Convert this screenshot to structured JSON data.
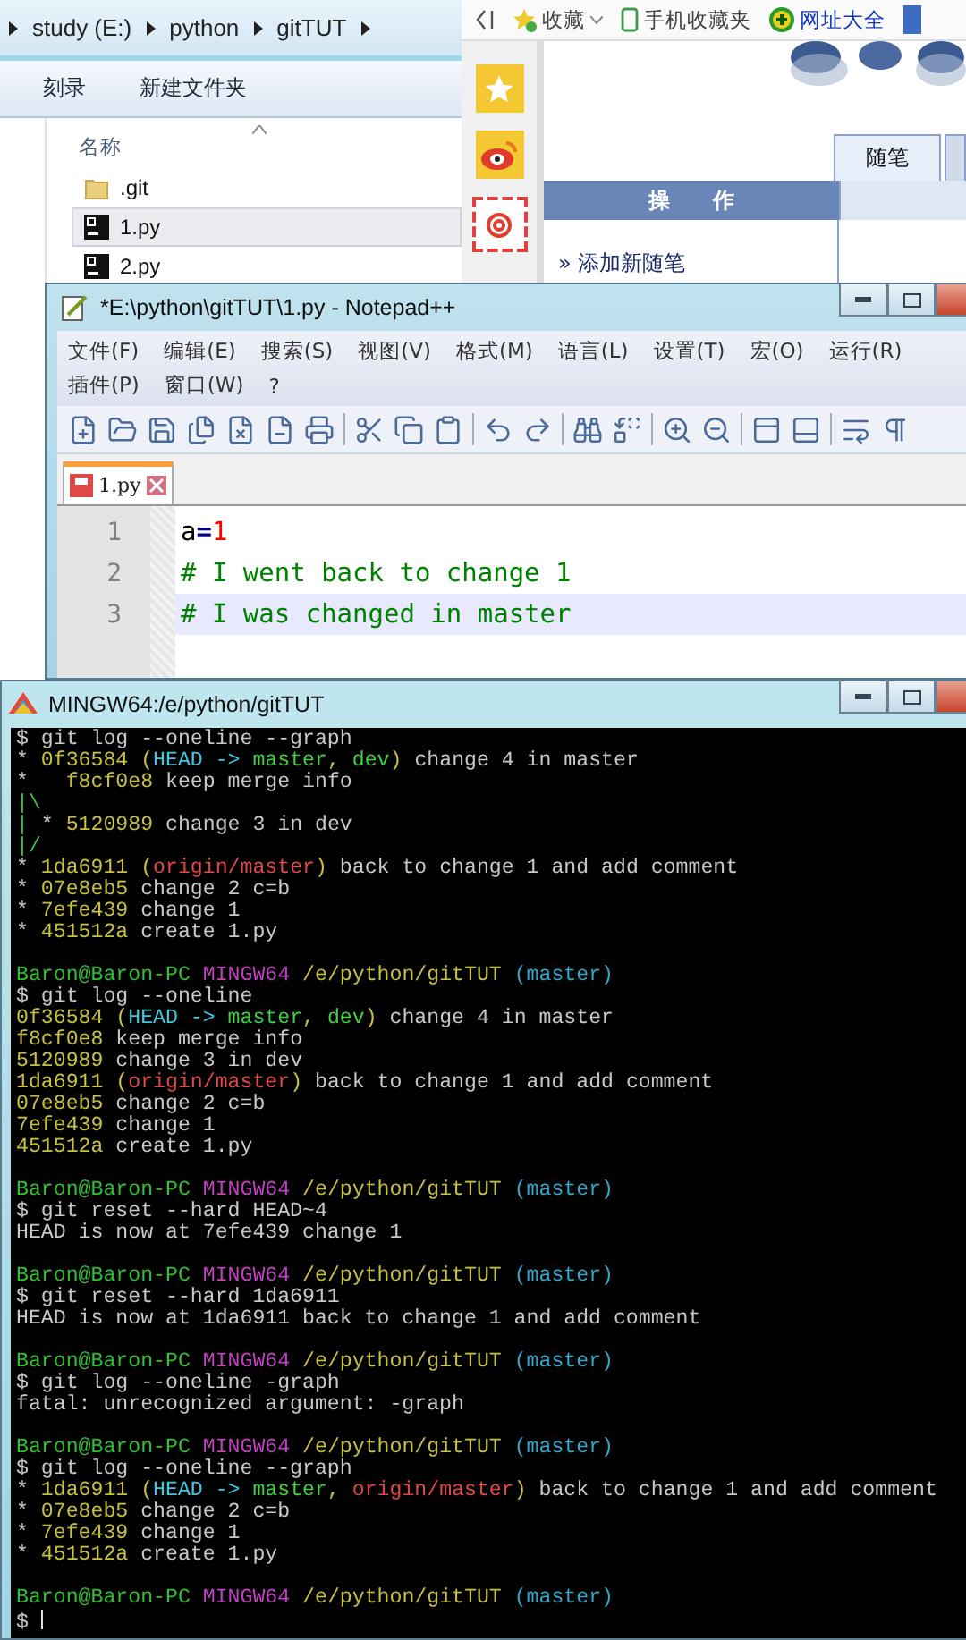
{
  "explorer": {
    "breadcrumb": [
      "study (E:)",
      "python",
      "gitTUT"
    ],
    "toolbar": [
      "刻录",
      "新建文件夹"
    ],
    "column": "名称",
    "files": [
      {
        "name": ".git",
        "kind": "folder",
        "selected": false
      },
      {
        "name": "1.py",
        "kind": "python",
        "selected": true
      },
      {
        "name": "2.py",
        "kind": "python",
        "selected": false
      }
    ]
  },
  "browser": {
    "bookmarks": [
      {
        "label": "收藏",
        "kind": "favorites"
      },
      {
        "label": "手机收藏夹",
        "kind": "phone"
      },
      {
        "label": "网址大全",
        "kind": "nav"
      }
    ],
    "tabs": [
      {
        "label": "随笔",
        "selected": true
      },
      {
        "selected": false
      }
    ],
    "panel_header": "操　　作",
    "link": "» 添加新随笔"
  },
  "notepad": {
    "title": "*E:\\python\\gitTUT\\1.py - Notepad++",
    "menu_rows": [
      [
        "文件(F)",
        "编辑(E)",
        "搜索(S)",
        "视图(V)",
        "格式(M)",
        "语言(L)",
        "设置(T)",
        "宏(O)",
        "运行(R)"
      ],
      [
        "插件(P)",
        "窗口(W)",
        "?"
      ]
    ],
    "tabs": [
      {
        "label": "1.py",
        "selected": true,
        "modified": true
      }
    ],
    "lines": [
      {
        "number": "1",
        "current": false,
        "tokens": [
          {
            "kind": "identifier",
            "text": "a"
          },
          {
            "kind": "operator",
            "text": "="
          },
          {
            "kind": "number",
            "text": "1"
          }
        ]
      },
      {
        "number": "2",
        "current": false,
        "tokens": [
          {
            "kind": "comment",
            "text": "# I went back to change 1"
          }
        ]
      },
      {
        "number": "3",
        "current": true,
        "tokens": [
          {
            "kind": "comment",
            "text": "# I was changed in master"
          }
        ]
      }
    ]
  },
  "terminal": {
    "title": "MINGW64:/e/python/gitTUT",
    "lines": [
      {
        "kind": "output",
        "segments": [
          {
            "kind": "text",
            "text": "$ git log --oneline --graph"
          }
        ]
      },
      {
        "kind": "output",
        "segments": [
          {
            "kind": "text",
            "text": "* "
          },
          {
            "kind": "hash",
            "text": "0f36584"
          },
          {
            "kind": "paren",
            "text": " ("
          },
          {
            "kind": "head",
            "text": "HEAD -> "
          },
          {
            "kind": "branch",
            "text": "master"
          },
          {
            "kind": "paren",
            "text": ", "
          },
          {
            "kind": "branch",
            "text": "dev"
          },
          {
            "kind": "paren",
            "text": ")"
          },
          {
            "kind": "text",
            "text": " change 4 in master"
          }
        ]
      },
      {
        "kind": "output",
        "segments": [
          {
            "kind": "text",
            "text": "*   "
          },
          {
            "kind": "hash",
            "text": "f8cf0e8"
          },
          {
            "kind": "text",
            "text": " keep merge info"
          }
        ]
      },
      {
        "kind": "output",
        "segments": [
          {
            "kind": "graph",
            "text": "|\\"
          }
        ]
      },
      {
        "kind": "output",
        "segments": [
          {
            "kind": "graph",
            "text": "|"
          },
          {
            "kind": "text",
            "text": " * "
          },
          {
            "kind": "hash",
            "text": "5120989"
          },
          {
            "kind": "text",
            "text": " change 3 in dev"
          }
        ]
      },
      {
        "kind": "output",
        "segments": [
          {
            "kind": "graph",
            "text": "|/"
          }
        ]
      },
      {
        "kind": "output",
        "segments": [
          {
            "kind": "text",
            "text": "* "
          },
          {
            "kind": "hash",
            "text": "1da6911"
          },
          {
            "kind": "paren",
            "text": " ("
          },
          {
            "kind": "remote",
            "text": "origin/master"
          },
          {
            "kind": "paren",
            "text": ")"
          },
          {
            "kind": "text",
            "text": " back to change 1 and add comment"
          }
        ]
      },
      {
        "kind": "output",
        "segments": [
          {
            "kind": "text",
            "text": "* "
          },
          {
            "kind": "hash",
            "text": "07e8eb5"
          },
          {
            "kind": "text",
            "text": " change 2 c=b"
          }
        ]
      },
      {
        "kind": "output",
        "segments": [
          {
            "kind": "text",
            "text": "* "
          },
          {
            "kind": "hash",
            "text": "7efe439"
          },
          {
            "kind": "text",
            "text": " change 1"
          }
        ]
      },
      {
        "kind": "output",
        "segments": [
          {
            "kind": "text",
            "text": "* "
          },
          {
            "kind": "hash",
            "text": "451512a"
          },
          {
            "kind": "text",
            "text": " create 1.py"
          }
        ]
      },
      {
        "kind": "blank"
      },
      {
        "kind": "prompt",
        "user": "Baron@Baron-PC",
        "host": "MINGW64",
        "path": "/e/python/gitTUT",
        "branch": "(master)"
      },
      {
        "kind": "output",
        "segments": [
          {
            "kind": "text",
            "text": "$ git log --oneline"
          }
        ]
      },
      {
        "kind": "output",
        "segments": [
          {
            "kind": "hash",
            "text": "0f36584"
          },
          {
            "kind": "paren",
            "text": " ("
          },
          {
            "kind": "head",
            "text": "HEAD -> "
          },
          {
            "kind": "branch",
            "text": "master"
          },
          {
            "kind": "paren",
            "text": ", "
          },
          {
            "kind": "branch",
            "text": "dev"
          },
          {
            "kind": "paren",
            "text": ")"
          },
          {
            "kind": "text",
            "text": " change 4 in master"
          }
        ]
      },
      {
        "kind": "output",
        "segments": [
          {
            "kind": "hash",
            "text": "f8cf0e8"
          },
          {
            "kind": "text",
            "text": " keep merge info"
          }
        ]
      },
      {
        "kind": "output",
        "segments": [
          {
            "kind": "hash",
            "text": "5120989"
          },
          {
            "kind": "text",
            "text": " change 3 in dev"
          }
        ]
      },
      {
        "kind": "output",
        "segments": [
          {
            "kind": "hash",
            "text": "1da6911"
          },
          {
            "kind": "paren",
            "text": " ("
          },
          {
            "kind": "remote",
            "text": "origin/master"
          },
          {
            "kind": "paren",
            "text": ")"
          },
          {
            "kind": "text",
            "text": " back to change 1 and add comment"
          }
        ]
      },
      {
        "kind": "output",
        "segments": [
          {
            "kind": "hash",
            "text": "07e8eb5"
          },
          {
            "kind": "text",
            "text": " change 2 c=b"
          }
        ]
      },
      {
        "kind": "output",
        "segments": [
          {
            "kind": "hash",
            "text": "7efe439"
          },
          {
            "kind": "text",
            "text": " change 1"
          }
        ]
      },
      {
        "kind": "output",
        "segments": [
          {
            "kind": "hash",
            "text": "451512a"
          },
          {
            "kind": "text",
            "text": " create 1.py"
          }
        ]
      },
      {
        "kind": "blank"
      },
      {
        "kind": "prompt",
        "user": "Baron@Baron-PC",
        "host": "MINGW64",
        "path": "/e/python/gitTUT",
        "branch": "(master)"
      },
      {
        "kind": "output",
        "segments": [
          {
            "kind": "text",
            "text": "$ git reset --hard HEAD~4"
          }
        ]
      },
      {
        "kind": "output",
        "segments": [
          {
            "kind": "text",
            "text": "HEAD is now at 7efe439 change 1"
          }
        ]
      },
      {
        "kind": "blank"
      },
      {
        "kind": "prompt",
        "user": "Baron@Baron-PC",
        "host": "MINGW64",
        "path": "/e/python/gitTUT",
        "branch": "(master)"
      },
      {
        "kind": "output",
        "segments": [
          {
            "kind": "text",
            "text": "$ git reset --hard 1da6911"
          }
        ]
      },
      {
        "kind": "output",
        "segments": [
          {
            "kind": "text",
            "text": "HEAD is now at 1da6911 back to change 1 and add comment"
          }
        ]
      },
      {
        "kind": "blank"
      },
      {
        "kind": "prompt",
        "user": "Baron@Baron-PC",
        "host": "MINGW64",
        "path": "/e/python/gitTUT",
        "branch": "(master)"
      },
      {
        "kind": "output",
        "segments": [
          {
            "kind": "text",
            "text": "$ git log --oneline -graph"
          }
        ]
      },
      {
        "kind": "output",
        "segments": [
          {
            "kind": "text",
            "text": "fatal: unrecognized argument: -graph"
          }
        ]
      },
      {
        "kind": "blank"
      },
      {
        "kind": "prompt",
        "user": "Baron@Baron-PC",
        "host": "MINGW64",
        "path": "/e/python/gitTUT",
        "branch": "(master)"
      },
      {
        "kind": "output",
        "segments": [
          {
            "kind": "text",
            "text": "$ git log --oneline --graph"
          }
        ]
      },
      {
        "kind": "output",
        "segments": [
          {
            "kind": "text",
            "text": "* "
          },
          {
            "kind": "hash",
            "text": "1da6911"
          },
          {
            "kind": "paren",
            "text": " ("
          },
          {
            "kind": "head",
            "text": "HEAD -> "
          },
          {
            "kind": "branch",
            "text": "master"
          },
          {
            "kind": "paren",
            "text": ", "
          },
          {
            "kind": "remote",
            "text": "origin/master"
          },
          {
            "kind": "paren",
            "text": ")"
          },
          {
            "kind": "text",
            "text": " back to change 1 and add comment"
          }
        ]
      },
      {
        "kind": "output",
        "segments": [
          {
            "kind": "text",
            "text": "* "
          },
          {
            "kind": "hash",
            "text": "07e8eb5"
          },
          {
            "kind": "text",
            "text": " change 2 c=b"
          }
        ]
      },
      {
        "kind": "output",
        "segments": [
          {
            "kind": "text",
            "text": "* "
          },
          {
            "kind": "hash",
            "text": "7efe439"
          },
          {
            "kind": "text",
            "text": " change 1"
          }
        ]
      },
      {
        "kind": "output",
        "segments": [
          {
            "kind": "text",
            "text": "* "
          },
          {
            "kind": "hash",
            "text": "451512a"
          },
          {
            "kind": "text",
            "text": " create 1.py"
          }
        ]
      },
      {
        "kind": "blank"
      },
      {
        "kind": "prompt",
        "user": "Baron@Baron-PC",
        "host": "MINGW64",
        "path": "/e/python/gitTUT",
        "branch": "(master)"
      },
      {
        "kind": "output",
        "segments": [
          {
            "kind": "text",
            "text": "$ "
          },
          {
            "kind": "cursor"
          }
        ]
      }
    ]
  }
}
